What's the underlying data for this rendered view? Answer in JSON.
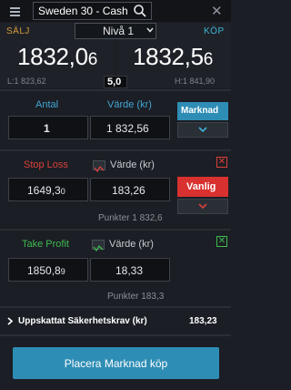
{
  "header": {
    "instrument": "Sweden 30 - Cash",
    "level": "Nivå 1"
  },
  "prices": {
    "sell_label": "SÄLJ",
    "buy_label": "KÖP",
    "sell_main": "1832,0",
    "sell_small": "6",
    "buy_main": "1832,5",
    "buy_small": "6",
    "low": "L:1 823,62",
    "high": "H:1 841,90",
    "spread": "5,0"
  },
  "order": {
    "quantity_label": "Antal",
    "value_label": "Värde (kr)",
    "quantity": "1",
    "value": "1 832,56",
    "type_button": "Marknad"
  },
  "stop_loss": {
    "label": "Stop Loss",
    "value_label": "Värde (kr)",
    "level_main": "1649,3",
    "level_small": "0",
    "value": "183,26",
    "type_button": "Vanlig",
    "points": "Punkter 1 832,6"
  },
  "take_profit": {
    "label": "Take Profit",
    "value_label": "Värde (kr)",
    "level_main": "1850,8",
    "level_small": "9",
    "value": "18,33",
    "points": "Punkter 183,3"
  },
  "summary": {
    "label": "Uppskattat Säkerhetskrav (kr)",
    "value": "183,23"
  },
  "place_button": "Placera Marknad köp",
  "colors": {
    "accent_blue": "#2e8db5",
    "sell_orange": "#d69a3a",
    "stop_red": "#d9312f",
    "profit_green": "#3fb950"
  }
}
